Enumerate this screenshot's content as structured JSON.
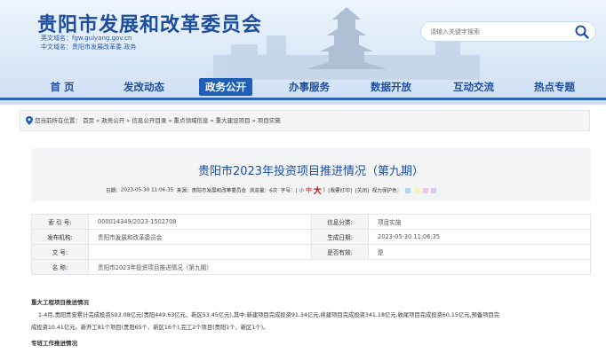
{
  "header": {
    "site_title": "贵阳市发展和改革委员会",
    "en_domain": "英文域名：fgw.guiyang.gov.cn",
    "cn_domain": "中文域名：贵阳市发展改革委.政务",
    "search_placeholder": "请输入关键字搜索"
  },
  "nav": [
    "首 页",
    "发改动态",
    "政务公开",
    "办事服务",
    "数据开放",
    "互动交流",
    "热点专题"
  ],
  "breadcrumb": {
    "prefix": "您当前所在位置：",
    "items": [
      "首页",
      "政务公开",
      "信息公开目录",
      "重点领域信息",
      "重大建设项目",
      "项目实施"
    ],
    "separator": "»"
  },
  "article": {
    "title": "贵阳市2023年投资项目推进情况（第九期）",
    "date_label": "日期：",
    "date": "2023-05-30 11:06:35",
    "source_label": "来源：",
    "source": "贵阳市发展和改革委员会",
    "views_label": "浏览量：",
    "views": "6次",
    "font_label": "字号：[",
    "font_small": "小",
    "font_mid": "中",
    "font_big": "大",
    "font_end": "]",
    "print": "[我要打印]",
    "close": "[关闭]",
    "color_label": "视力保护色："
  },
  "eye_colors": [
    "#a9d6f5",
    "#f7f1b2",
    "#f6c3d9",
    "#d8c9f0",
    "#f2f2f2"
  ],
  "info": {
    "index_label": "索 引 号:",
    "index": "000014349/2023-1502708",
    "category_label": "信息分类:",
    "category": "项目实施",
    "publisher_label": "发布机构:",
    "publisher": "贵阳市发展和改革委员会",
    "gen_date_label": "生成日期:",
    "gen_date": "2023-05-30 11:06:35",
    "doc_no_label": "文 号:",
    "doc_no": "",
    "valid_label": "是否有效:",
    "valid": "是",
    "name_label": "名 称:",
    "name": "贵阳市2023年投资项目推进情况（第九期）"
  },
  "content": {
    "heading1": "重大工程项目推进情况",
    "para1_line1": "1-4月,贵阳贵安累计完成投资503.08亿元(贵阳449.63亿元、新区53.45亿元),其中:新建项目完成投资91.34亿元,续建项目完成投资341.18亿元,收尾项目完成投资60.15亿元,预备项目完",
    "para1_line2": "成投资10.41亿元。新开工81个项目(贵阳65个、新区16个),完工2个项目(贵阳1个、新区1个)。",
    "heading2": "专班工作推进情况"
  }
}
